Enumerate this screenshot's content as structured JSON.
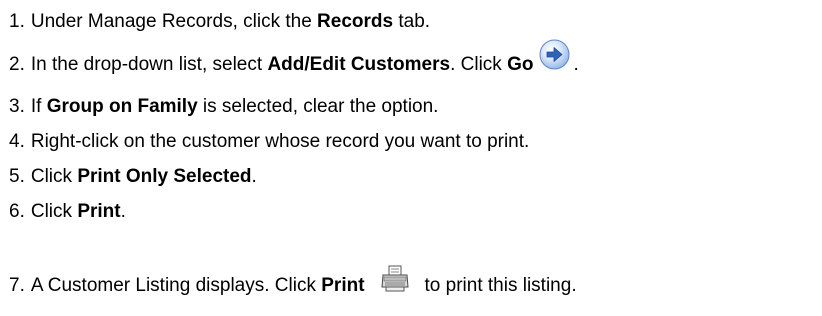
{
  "steps": [
    {
      "num": "1.",
      "pre": "Under Manage Records, click the ",
      "bold": "Records",
      "post": " tab."
    },
    {
      "num": "2.",
      "pre": "In the drop-down list, select ",
      "bold": "Add/Edit Customers",
      "mid": ". Click ",
      "bold2": "Go",
      "icon": "go-arrow-icon",
      "post": "."
    },
    {
      "num": "3.",
      "pre": "If ",
      "bold": "Group on Family",
      "post": " is selected, clear the option."
    },
    {
      "num": "4.",
      "text": "Right-click on the customer whose record you want to print."
    },
    {
      "num": "5.",
      "pre": "Click ",
      "bold": "Print Only Selected",
      "post": "."
    },
    {
      "num": "6.",
      "pre": "Click ",
      "bold": "Print",
      "post": "."
    },
    {
      "num": "7.",
      "pre": "A Customer Listing displays. Click ",
      "bold": "Print",
      "icon": "printer-icon",
      "post": "to print this listing."
    }
  ],
  "colors": {
    "go_icon_blue": "#3a74c9",
    "go_icon_light": "#cfe0f8"
  }
}
